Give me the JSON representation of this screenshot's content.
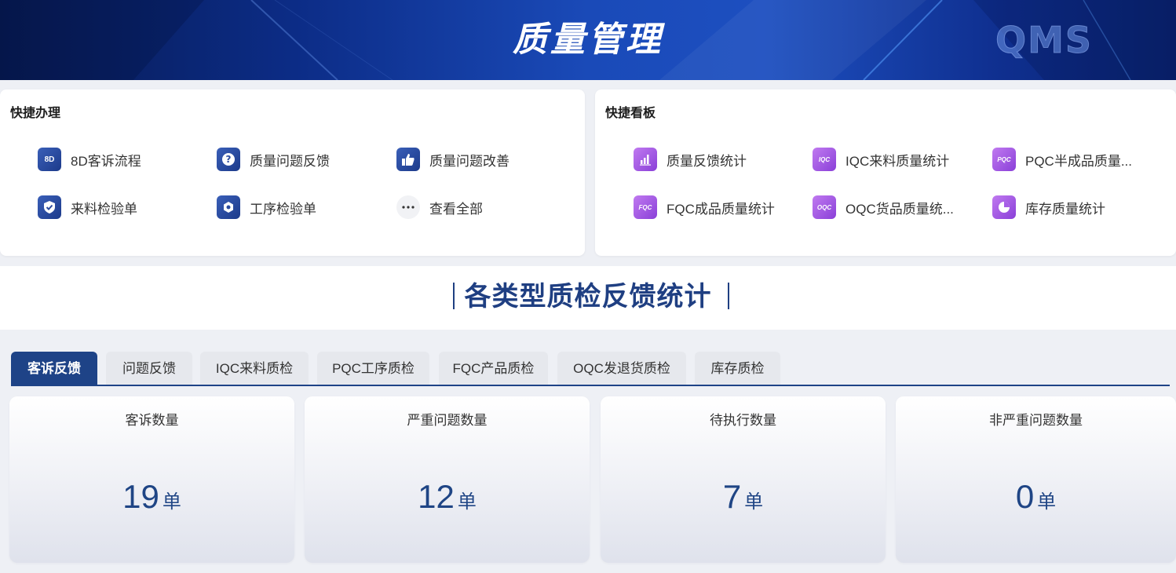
{
  "header": {
    "title": "质量管理",
    "logo": "QMS"
  },
  "quick_actions": {
    "title": "快捷办理",
    "items": [
      {
        "label": "8D客诉流程",
        "icon": "8d-icon",
        "icon_text": "8D"
      },
      {
        "label": "质量问题反馈",
        "icon": "question-icon"
      },
      {
        "label": "质量问题改善",
        "icon": "thumbs-up-icon"
      },
      {
        "label": "来料检验单",
        "icon": "shield-check-icon"
      },
      {
        "label": "工序检验单",
        "icon": "hexagon-nut-icon"
      },
      {
        "label": "查看全部",
        "icon": "more-dots-icon"
      }
    ]
  },
  "quick_boards": {
    "title": "快捷看板",
    "items": [
      {
        "label": "质量反馈统计",
        "icon": "bar-chart-icon"
      },
      {
        "label": "IQC来料质量统计",
        "icon": "iqc-icon",
        "icon_text": "IQC"
      },
      {
        "label": "PQC半成品质量...",
        "icon": "pqc-icon",
        "icon_text": "PQC"
      },
      {
        "label": "FQC成品质量统计",
        "icon": "fqc-icon",
        "icon_text": "FQC"
      },
      {
        "label": "OQC货品质量统...",
        "icon": "oqc-icon",
        "icon_text": "OQC"
      },
      {
        "label": "库存质量统计",
        "icon": "pie-chart-icon"
      }
    ]
  },
  "section": {
    "title": "各类型质检反馈统计"
  },
  "tabs": [
    {
      "label": "客诉反馈",
      "active": true
    },
    {
      "label": "问题反馈",
      "active": false
    },
    {
      "label": "IQC来料质检",
      "active": false
    },
    {
      "label": "PQC工序质检",
      "active": false
    },
    {
      "label": "FQC产品质检",
      "active": false
    },
    {
      "label": "OQC发退货质检",
      "active": false
    },
    {
      "label": "库存质检",
      "active": false
    }
  ],
  "stats": [
    {
      "label": "客诉数量",
      "value": "19",
      "unit": "单"
    },
    {
      "label": "严重问题数量",
      "value": "12",
      "unit": "单"
    },
    {
      "label": "待执行数量",
      "value": "7",
      "unit": "单"
    },
    {
      "label": "非严重问题数量",
      "value": "0",
      "unit": "单"
    }
  ],
  "colors": {
    "primary": "#1e4387",
    "header_dark": "#071a52",
    "header_light": "#1d4fc0",
    "icon_blue": "#2a4a9e",
    "icon_purple": "#a65ee6",
    "value_text": "#1f4585"
  }
}
